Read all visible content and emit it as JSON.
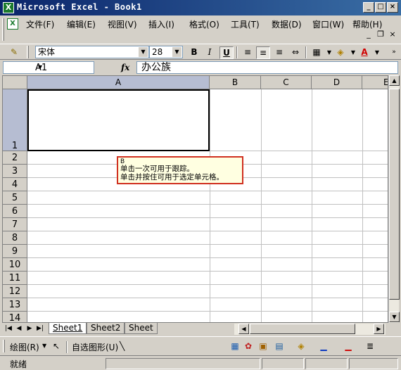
{
  "window": {
    "title": "Microsoft Excel - Book1",
    "app_icon": "X"
  },
  "menu": [
    "文件(F)",
    "编辑(E)",
    "视图(V)",
    "插入(I)",
    "格式(O)",
    "工具(T)",
    "数据(D)",
    "窗口(W)",
    "帮助(H)"
  ],
  "format_toolbar": {
    "font": "宋体",
    "size": "28",
    "bold": "B",
    "italic": "I",
    "underline": "U",
    "font_color": "A"
  },
  "formula_bar": {
    "name_box": "A1",
    "fx": "fx",
    "content": "办公族"
  },
  "grid": {
    "columns": [
      "A",
      "B",
      "C",
      "D",
      "E"
    ],
    "rows": [
      "1",
      "2",
      "3",
      "4",
      "5",
      "6",
      "7",
      "8",
      "9",
      "10",
      "11",
      "12",
      "13",
      "14"
    ],
    "selected_cell": "A1"
  },
  "tooltip": {
    "title": "B",
    "line1": "单击一次可用于跟踪。",
    "line2": "单击并按住可用于选定单元格。"
  },
  "sheet_tabs": [
    "Sheet1",
    "Sheet2",
    "Sheet"
  ],
  "draw_toolbar": {
    "draw": "绘图(R)",
    "autoshapes": "自选图形(U)"
  },
  "status": "就绪",
  "colors": {
    "title_bar": "#0a246a",
    "selection": "#b6bdd2",
    "tooltip_border": "#d03020",
    "tooltip_bg": "#ffffe1"
  }
}
